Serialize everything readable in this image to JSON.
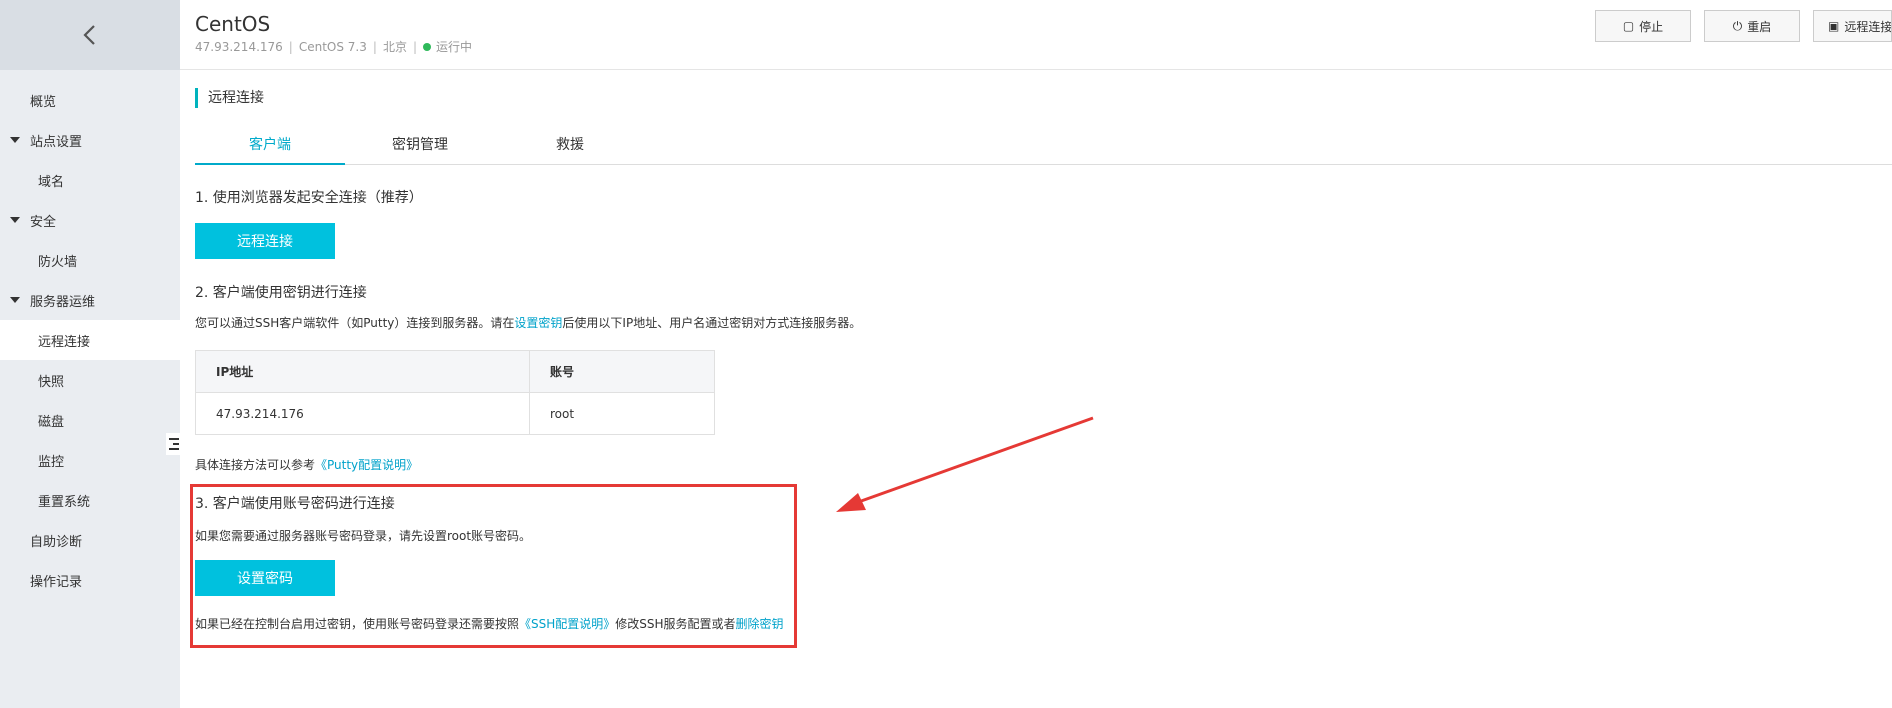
{
  "sidebar": {
    "back_icon": "chevron-left-icon",
    "items": [
      {
        "label": "概览",
        "kind": "lvl0"
      },
      {
        "label": "站点设置",
        "kind": "group"
      },
      {
        "label": "域名",
        "kind": "sub"
      },
      {
        "label": "安全",
        "kind": "group"
      },
      {
        "label": "防火墙",
        "kind": "sub"
      },
      {
        "label": "服务器运维",
        "kind": "group"
      },
      {
        "label": "远程连接",
        "kind": "sub",
        "active": true
      },
      {
        "label": "快照",
        "kind": "sub"
      },
      {
        "label": "磁盘",
        "kind": "sub"
      },
      {
        "label": "监控",
        "kind": "sub"
      },
      {
        "label": "重置系统",
        "kind": "sub"
      },
      {
        "label": "自助诊断",
        "kind": "lvl0"
      },
      {
        "label": "操作记录",
        "kind": "lvl0"
      }
    ]
  },
  "header": {
    "title": "CentOS",
    "ip": "47.93.214.176",
    "os": "CentOS 7.3",
    "region": "北京",
    "status": "运行中",
    "status_color": "#2fb95a",
    "buttons": {
      "stop": "停止",
      "restart": "重启",
      "remote": "远程连接"
    }
  },
  "main": {
    "section_title": "远程连接",
    "tabs": [
      "客户端",
      "密钥管理",
      "救援"
    ],
    "step1": {
      "title": "1. 使用浏览器发起安全连接（推荐）",
      "button": "远程连接"
    },
    "step2": {
      "title": "2. 客户端使用密钥进行连接",
      "desc_pre": "您可以通过SSH客户端软件（如Putty）连接到服务器。请在",
      "desc_link": "设置密钥",
      "desc_post": "后使用以下IP地址、用户名通过密钥对方式连接服务器。",
      "table": {
        "headers": [
          "IP地址",
          "账号"
        ],
        "row": [
          "47.93.214.176",
          "root"
        ]
      },
      "ref_pre": "具体连接方法可以参考",
      "ref_link": "《Putty配置说明》"
    },
    "step3": {
      "title": "3. 客户端使用账号密码进行连接",
      "desc": "如果您需要通过服务器账号密码登录，请先设置root账号密码。",
      "button": "设置密码",
      "note_pre": "如果已经在控制台启用过密钥，使用账号密码登录还需要按照",
      "note_link1": "《SSH配置说明》",
      "note_mid": "修改SSH服务配置或者",
      "note_link2": "删除密钥"
    }
  },
  "colors": {
    "accent": "#00c1de",
    "link": "#00a2ca",
    "annotation": "#e53935"
  }
}
